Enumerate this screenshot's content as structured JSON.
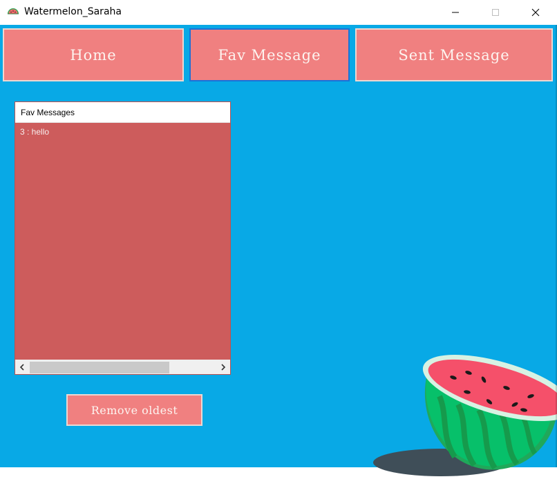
{
  "window": {
    "title": "Watermelon_Saraha",
    "app_icon": "watermelon-icon",
    "controls": [
      "minimize-icon",
      "maximize-icon",
      "close-icon"
    ]
  },
  "nav": {
    "home_label": "Home",
    "fav_label": "Fav Message",
    "sent_label": "Sent Message",
    "active": "Fav Message"
  },
  "fav_list": {
    "header": "Fav Messages",
    "items": [
      "3 : hello"
    ]
  },
  "actions": {
    "remove_label": "Remove oldest"
  },
  "colors": {
    "background": "#08a9e6",
    "button": "#f08080",
    "list_background": "#cd5c5c",
    "active_border": "#1a72d8"
  },
  "decoration": {
    "illustration": "watermelon-slice-illustration"
  }
}
